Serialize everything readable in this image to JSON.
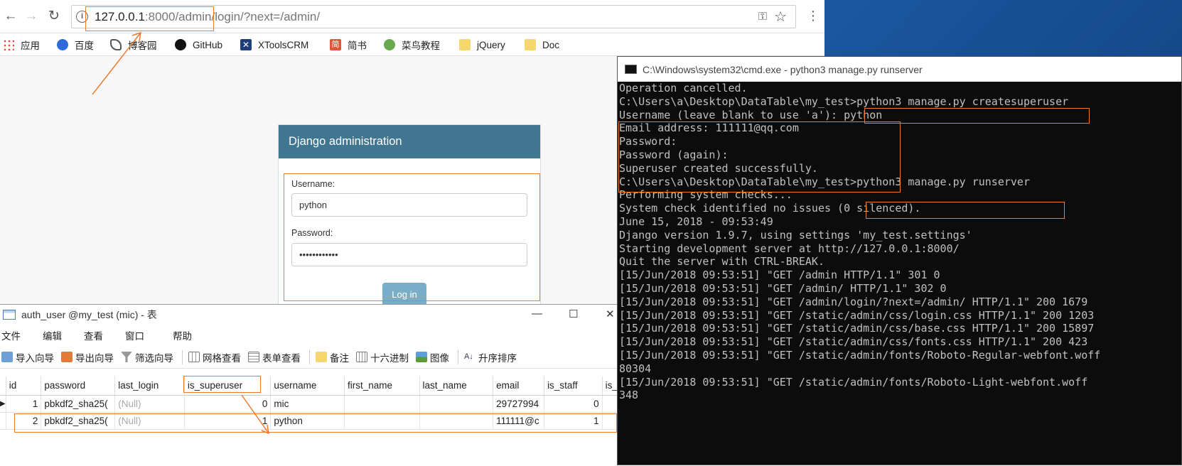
{
  "browser": {
    "url_host": "127.0.0.1",
    "url_port": ":8000",
    "url_path": "/admin/login/?next=/admin/",
    "bookmarks": [
      "应用",
      "百度",
      "博客园",
      "GitHub",
      "XToolsCRM",
      "简书",
      "菜鸟教程",
      "jQuery",
      "Doc"
    ]
  },
  "login": {
    "header": "Django administration",
    "username_label": "Username:",
    "username_value": "python",
    "password_label": "Password:",
    "password_value": "••••••••••••",
    "submit_label": "Log in"
  },
  "navicat": {
    "title": "auth_user @my_test (mic) - 表",
    "menu": [
      "文件",
      "编辑",
      "查看",
      "窗口",
      "帮助"
    ],
    "tools": [
      "导入向导",
      "导出向导",
      "筛选向导",
      "网格查看",
      "表单查看",
      "备注",
      "十六进制",
      "图像",
      "升序排序"
    ],
    "columns": [
      "id",
      "password",
      "last_login",
      "is_superuser",
      "username",
      "first_name",
      "last_name",
      "email",
      "is_staff",
      "is_"
    ],
    "rows": [
      [
        "1",
        "pbkdf2_sha25(",
        "(Null)",
        "0",
        "mic",
        "",
        "",
        "29727994",
        "0",
        ""
      ],
      [
        "2",
        "pbkdf2_sha25(",
        "(Null)",
        "1",
        "python",
        "",
        "",
        "111111@c",
        "1",
        ""
      ]
    ]
  },
  "cmd": {
    "title": "C:\\Windows\\system32\\cmd.exe - python3  manage.py runserver",
    "lines": [
      "Operation cancelled.",
      "",
      "C:\\Users\\a\\Desktop\\DataTable\\my_test>python3 manage.py createsuperuser",
      "Username (leave blank to use 'a'): python",
      "Email address: 111111@qq.com",
      "Password:",
      "Password (again):",
      "Superuser created successfully.",
      "",
      "C:\\Users\\a\\Desktop\\DataTable\\my_test>python3 manage.py runserver",
      "Performing system checks...",
      "",
      "System check identified no issues (0 silenced).",
      "June 15, 2018 - 09:53:49",
      "Django version 1.9.7, using settings 'my_test.settings'",
      "Starting development server at http://127.0.0.1:8000/",
      "Quit the server with CTRL-BREAK.",
      "[15/Jun/2018 09:53:51] \"GET /admin HTTP/1.1\" 301 0",
      "[15/Jun/2018 09:53:51] \"GET /admin/ HTTP/1.1\" 302 0",
      "[15/Jun/2018 09:53:51] \"GET /admin/login/?next=/admin/ HTTP/1.1\" 200 1679",
      "[15/Jun/2018 09:53:51] \"GET /static/admin/css/login.css HTTP/1.1\" 200 1203",
      "[15/Jun/2018 09:53:51] \"GET /static/admin/css/base.css HTTP/1.1\" 200 15897",
      "[15/Jun/2018 09:53:51] \"GET /static/admin/css/fonts.css HTTP/1.1\" 200 423",
      "[15/Jun/2018 09:53:51] \"GET /static/admin/fonts/Roboto-Regular-webfont.woff",
      "80304",
      "[15/Jun/2018 09:53:51] \"GET /static/admin/fonts/Roboto-Light-webfont.woff",
      "348"
    ]
  }
}
